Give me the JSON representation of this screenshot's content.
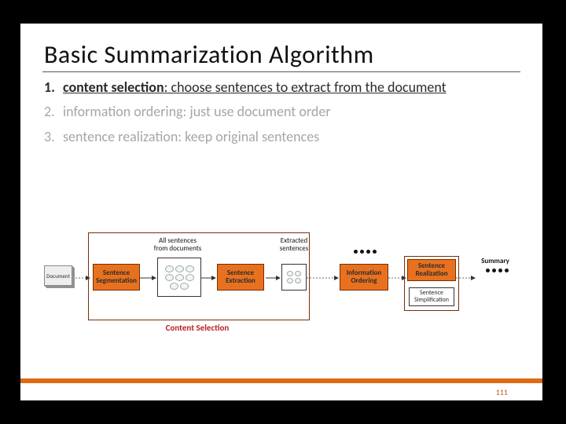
{
  "page_number": "111",
  "title": "Basic Summarization Algorithm",
  "items": [
    {
      "num": "1.",
      "label": "content selection",
      "rest": ": choose sentences to extract from the document",
      "highlight": true
    },
    {
      "num": "2.",
      "label": "information ordering",
      "rest": ": just use document order",
      "highlight": false
    },
    {
      "num": "3.",
      "label": "sentence realization",
      "rest": ": keep original sentences",
      "highlight": false
    }
  ],
  "diagram": {
    "doc_label": "Document",
    "all_sent_caption": "All sentences\nfrom documents",
    "extracted_caption": "Extracted\nsentences",
    "seg_label": "Sentence\nSegmentation",
    "ext_label": "Sentence\nExtraction",
    "content_sel_label": "Content Selection",
    "info_order_label": "Information\nOrdering",
    "sent_real_label": "Sentence\nRealization",
    "sent_simp_label": "Sentence\nSimplification",
    "summary_label": "Summary"
  }
}
